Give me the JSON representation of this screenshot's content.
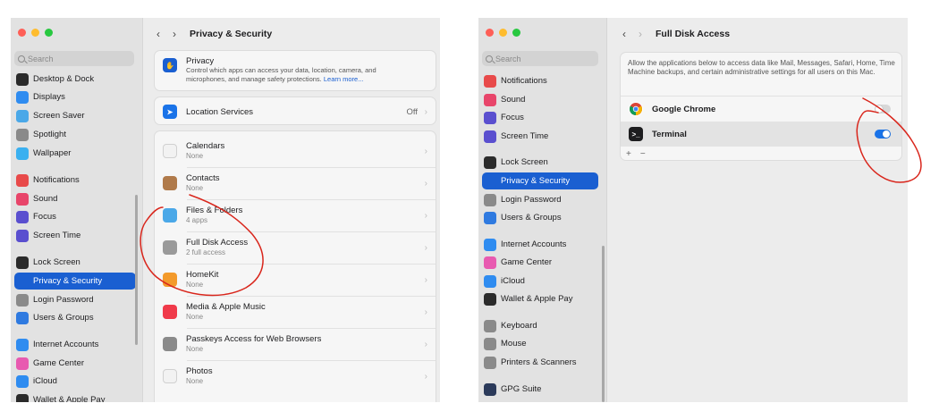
{
  "colors": {
    "accent": "#1a5fd1",
    "toggle_on": "#1a73e8",
    "annotation": "#d9261c"
  },
  "left": {
    "search_placeholder": "Search",
    "sidebar": [
      {
        "label": "Desktop & Dock",
        "icon": "dock-icon",
        "color": "#2b2b2b"
      },
      {
        "label": "Displays",
        "icon": "sun-icon",
        "color": "#2f8cf0"
      },
      {
        "label": "Screen Saver",
        "icon": "screen-saver-icon",
        "color": "#4aa8e8"
      },
      {
        "label": "Spotlight",
        "icon": "magnifier-icon",
        "color": "#8a8a8a"
      },
      {
        "label": "Wallpaper",
        "icon": "wallpaper-icon",
        "color": "#3ab0f0"
      },
      {
        "label": "Notifications",
        "icon": "bell-icon",
        "color": "#e84a4a"
      },
      {
        "label": "Sound",
        "icon": "speaker-icon",
        "color": "#e8456a"
      },
      {
        "label": "Focus",
        "icon": "moon-icon",
        "color": "#5a4fcf"
      },
      {
        "label": "Screen Time",
        "icon": "hourglass-icon",
        "color": "#5a4fcf"
      },
      {
        "label": "Lock Screen",
        "icon": "lock-icon",
        "color": "#2b2b2b"
      },
      {
        "label": "Privacy & Security",
        "icon": "hand-icon",
        "color": "#1a5fd1"
      },
      {
        "label": "Login Password",
        "icon": "login-icon",
        "color": "#8a8a8a"
      },
      {
        "label": "Users & Groups",
        "icon": "users-icon",
        "color": "#2f7ae0"
      },
      {
        "label": "Internet Accounts",
        "icon": "at-icon",
        "color": "#2f8cf0"
      },
      {
        "label": "Game Center",
        "icon": "game-center-icon",
        "color": "#e85ab0"
      },
      {
        "label": "iCloud",
        "icon": "cloud-icon",
        "color": "#2f8cf0"
      },
      {
        "label": "Wallet & Apple Pay",
        "icon": "wallet-icon",
        "color": "#2b2b2b"
      }
    ],
    "active_item": "Privacy & Security",
    "title": "Privacy & Security",
    "privacy": {
      "title": "Privacy",
      "description": "Control which apps can access your data, location, camera, and microphones, and manage safety protections.",
      "learn_more": "Learn more..."
    },
    "location": {
      "label": "Location Services",
      "value": "Off"
    },
    "rows": [
      {
        "label": "Calendars",
        "sub": "None",
        "icon": "calendar-icon",
        "color": "#f2f2f2"
      },
      {
        "label": "Contacts",
        "sub": "None",
        "icon": "contacts-icon",
        "color": "#b07a4a"
      },
      {
        "label": "Files & Folders",
        "sub": "4 apps",
        "icon": "folder-icon",
        "color": "#4aa8e8"
      },
      {
        "label": "Full Disk Access",
        "sub": "2 full access",
        "icon": "disk-icon",
        "color": "#9a9a9a"
      },
      {
        "label": "HomeKit",
        "sub": "None",
        "icon": "home-icon",
        "color": "#f39a2b"
      },
      {
        "label": "Media & Apple Music",
        "sub": "None",
        "icon": "music-icon",
        "color": "#f03a4a"
      },
      {
        "label": "Passkeys Access for Web Browsers",
        "sub": "None",
        "icon": "passkey-icon",
        "color": "#8a8a8a"
      },
      {
        "label": "Photos",
        "sub": "None",
        "icon": "photos-icon",
        "color": "#f2f2f2"
      }
    ]
  },
  "right": {
    "search_placeholder": "Search",
    "sidebar": [
      {
        "label": "Notifications",
        "icon": "bell-icon",
        "color": "#e84a4a"
      },
      {
        "label": "Sound",
        "icon": "speaker-icon",
        "color": "#e8456a"
      },
      {
        "label": "Focus",
        "icon": "moon-icon",
        "color": "#5a4fcf"
      },
      {
        "label": "Screen Time",
        "icon": "hourglass-icon",
        "color": "#5a4fcf"
      },
      {
        "label": "Lock Screen",
        "icon": "lock-icon",
        "color": "#2b2b2b"
      },
      {
        "label": "Privacy & Security",
        "icon": "hand-icon",
        "color": "#1a5fd1"
      },
      {
        "label": "Login Password",
        "icon": "login-icon",
        "color": "#8a8a8a"
      },
      {
        "label": "Users & Groups",
        "icon": "users-icon",
        "color": "#2f7ae0"
      },
      {
        "label": "Internet Accounts",
        "icon": "at-icon",
        "color": "#2f8cf0"
      },
      {
        "label": "Game Center",
        "icon": "game-center-icon",
        "color": "#e85ab0"
      },
      {
        "label": "iCloud",
        "icon": "cloud-icon",
        "color": "#2f8cf0"
      },
      {
        "label": "Wallet & Apple Pay",
        "icon": "wallet-icon",
        "color": "#2b2b2b"
      },
      {
        "label": "Keyboard",
        "icon": "keyboard-icon",
        "color": "#8a8a8a"
      },
      {
        "label": "Mouse",
        "icon": "mouse-icon",
        "color": "#8a8a8a"
      },
      {
        "label": "Printers & Scanners",
        "icon": "printer-icon",
        "color": "#8a8a8a"
      },
      {
        "label": "GPG Suite",
        "icon": "gpg-icon",
        "color": "#2b3a5a"
      }
    ],
    "active_item": "Privacy & Security",
    "title": "Full Disk Access",
    "description": "Allow the applications below to access data like Mail, Messages, Safari, Home, Time Machine backups, and certain administrative settings for all users on this Mac.",
    "apps": [
      {
        "label": "Google Chrome",
        "icon": "chrome-icon",
        "enabled": false
      },
      {
        "label": "Terminal",
        "icon": "terminal-icon",
        "enabled": true
      }
    ],
    "add_label": "+",
    "remove_label": "−"
  },
  "icons": {
    "back": "‹",
    "forward": "›",
    "chevron": "›"
  }
}
